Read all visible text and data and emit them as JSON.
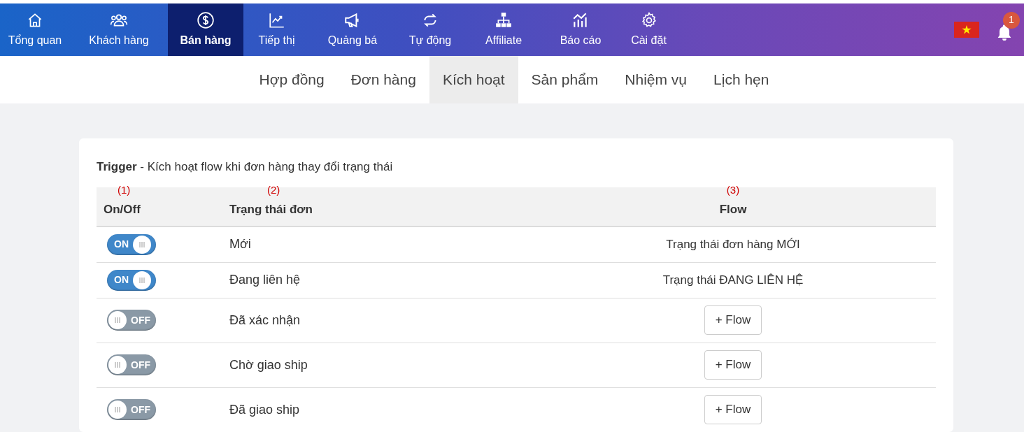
{
  "top_nav": {
    "items": [
      {
        "label": "Tổng quan",
        "kind": "home",
        "selected": false
      },
      {
        "label": "Khách hàng",
        "kind": "users",
        "selected": false
      },
      {
        "label": "Bán hàng",
        "kind": "dollar",
        "selected": true
      },
      {
        "label": "Tiếp thị",
        "kind": "chart",
        "selected": false
      },
      {
        "label": "Quảng bá",
        "kind": "megaphone",
        "selected": false
      },
      {
        "label": "Tự động",
        "kind": "repeat",
        "selected": false
      },
      {
        "label": "Affiliate",
        "kind": "sitemap",
        "selected": false
      },
      {
        "label": "Báo cáo",
        "kind": "bars",
        "selected": false
      },
      {
        "label": "Cài đặt",
        "kind": "gear",
        "selected": false
      }
    ],
    "notification_count": "1"
  },
  "sub_tabs": [
    {
      "label": "Hợp đồng",
      "selected": false
    },
    {
      "label": "Đơn hàng",
      "selected": false
    },
    {
      "label": "Kích hoạt",
      "selected": true
    },
    {
      "label": "Sản phẩm",
      "selected": false
    },
    {
      "label": "Nhiệm vụ",
      "selected": false
    },
    {
      "label": "Lịch hẹn",
      "selected": false
    }
  ],
  "card": {
    "title": "**Trigger** - Kích hoạt flow khi đơn hàng thay đổi trạng thái",
    "table": {
      "columns": [
        {
          "marker": "(1)",
          "label": "On/Off"
        },
        {
          "marker": "(2)",
          "label": "Trạng thái đơn"
        },
        {
          "marker": "(3)",
          "label": "Flow"
        }
      ],
      "rows": [
        {
          "on": true,
          "toggle_label": "ON",
          "status": "Mới",
          "flow": {
            "kind": "text",
            "label": "Trạng thái đơn hàng MỚI"
          }
        },
        {
          "on": true,
          "toggle_label": "ON",
          "status": "Đang liên hệ",
          "flow": {
            "kind": "text",
            "label": "Trạng thái ĐANG LIÊN HỆ"
          }
        },
        {
          "on": false,
          "toggle_label": "OFF",
          "status": "Đã xác nhận",
          "flow": {
            "kind": "button",
            "label": "+ Flow"
          }
        },
        {
          "on": false,
          "toggle_label": "OFF",
          "status": "Chờ giao ship",
          "flow": {
            "kind": "button",
            "label": "+ Flow"
          }
        },
        {
          "on": false,
          "toggle_label": "OFF",
          "status": "Đã giao ship",
          "flow": {
            "kind": "button",
            "label": "+ Flow"
          }
        }
      ]
    }
  }
}
